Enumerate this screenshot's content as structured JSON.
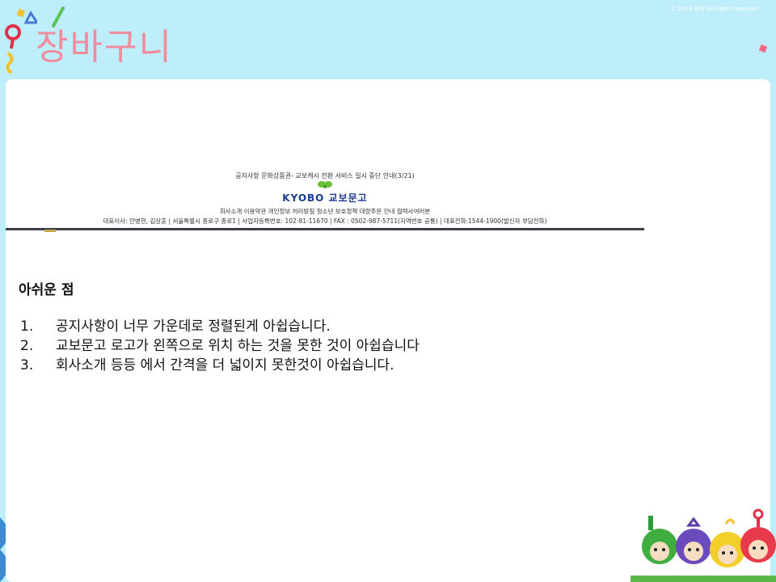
{
  "slide": {
    "title": "장바구니",
    "copyright": "© 2018 장바 All rights reserved"
  },
  "footer_screenshot": {
    "notice": "공지사항 문화상품권- 교보캐시 전환 서비스 일시 중단 안내(3/21)",
    "logo_text": "KYOBO 교보문고",
    "links": "회사소개 이용약관 개인정보 처리방침 청소년 보호정책 대량주문 안내 협력사여러분",
    "company_info": "대표이사: 안병현, 김상훈 | 서울특별시 종로구 종로1 | 사업자등록번호: 102-81-11670 | FAX : 0502-987-5711(지역번호 공통) | 대표전화:1544-1900(발신자 부담전화)"
  },
  "review": {
    "heading": "아쉬운 점",
    "items": [
      {
        "num": "1.",
        "text": "공지사항이 너무 가운데로 정렬된게 아쉽습니다."
      },
      {
        "num": "2.",
        "text": "교보문고 로고가 왼쪽으로 위치 하는 것을 못한 것이 아쉽습니다"
      },
      {
        "num": "3.",
        "text": "회사소개 등등 에서 간격을 더 넓이지 못한것이 아쉽습니다."
      }
    ]
  },
  "colors": {
    "background": "#bdeefa",
    "title": "#f08c9c",
    "card": "#ffffff",
    "kyobo_blue": "#1a3a8c",
    "kyobo_green": "#6abf3a"
  },
  "icons": [
    "magnifier-icon",
    "triangle-icon",
    "confetti-icon",
    "teletubbies-illustration"
  ]
}
